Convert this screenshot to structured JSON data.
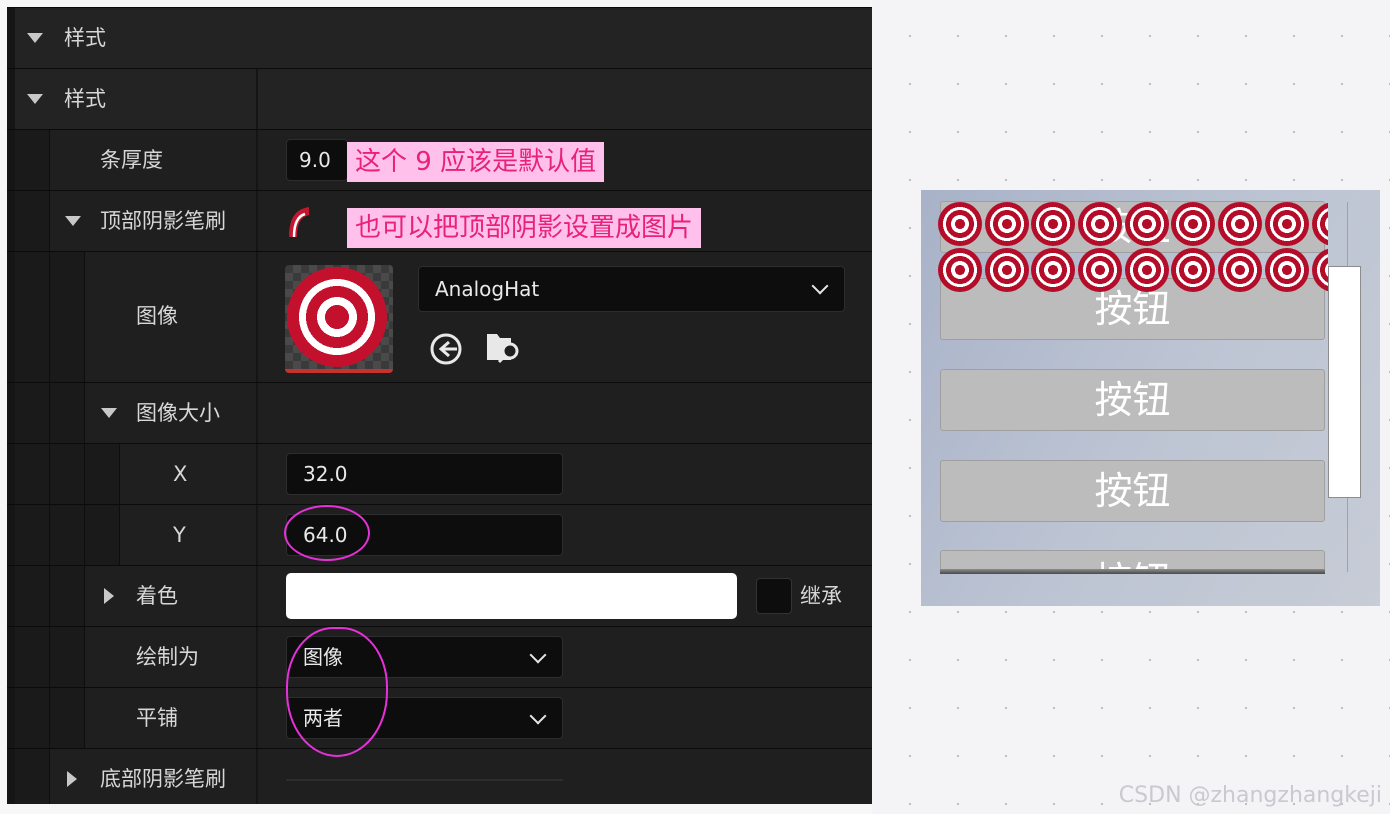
{
  "details": {
    "section_style_outer": "样式",
    "section_style_inner": "样式",
    "thickness": {
      "label": "条厚度",
      "value": "9.0"
    },
    "top_shadow_brush": {
      "label": "顶部阴影笔刷"
    },
    "image": {
      "label": "图像",
      "asset_name": "AnalogHat"
    },
    "image_size": {
      "label": "图像大小",
      "x_label": "X",
      "x_value": "32.0",
      "y_label": "Y",
      "y_value": "64.0"
    },
    "tint": {
      "label": "着色",
      "inherit_label": "继承"
    },
    "draw_as": {
      "label": "绘制为",
      "value": "图像"
    },
    "tiling": {
      "label": "平铺",
      "value": "两者"
    },
    "bottom_shadow_brush": {
      "label": "底部阴影笔刷"
    }
  },
  "annotations": {
    "note_default": "这个 9 应该是默认值",
    "note_image": "也可以把顶部阴影设置成图片"
  },
  "preview": {
    "buttons": [
      "按钮",
      "按钮",
      "按钮",
      "按钮",
      "按钮"
    ],
    "target_color": "#b30d2a"
  },
  "watermark": "CSDN @zhangzhangkeji",
  "colors": {
    "panel_bg": "#1f1f1f",
    "annotation_bg": "#ffc0ec",
    "annotation_text": "#e8217a",
    "highlight_ring": "#e531d9"
  }
}
